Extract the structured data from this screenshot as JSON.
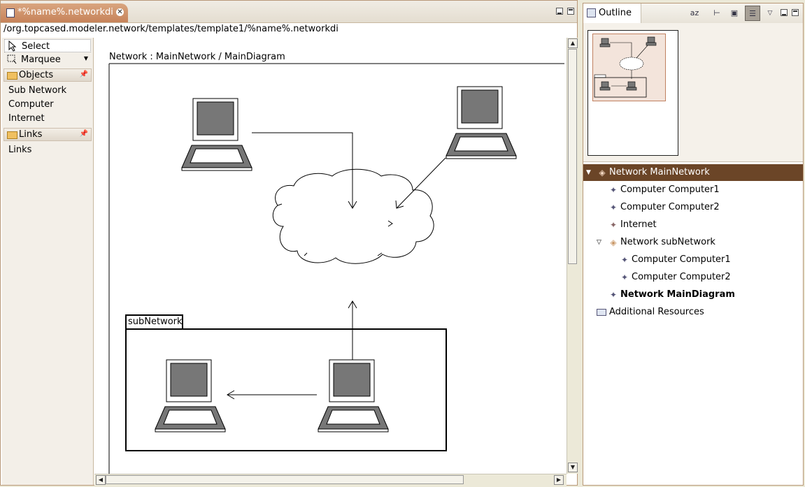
{
  "editor": {
    "tab_title": "*%name%.networkdi",
    "path": "/org.topcased.modeler.network/templates/template1/%name%.networkdi"
  },
  "palette": {
    "select_label": "Select",
    "marquee_label": "Marquee",
    "drawers": [
      {
        "label": "Objects",
        "items": [
          "Sub Network",
          "Computer",
          "Internet"
        ]
      },
      {
        "label": "Links",
        "items": [
          "Links"
        ]
      }
    ]
  },
  "diagram": {
    "frame_title": "Network : MainNetwork / MainDiagram",
    "subnetwork_label": "subNetwork"
  },
  "outline": {
    "tab_label": "Outline",
    "sort_icon_text": "az",
    "tree": [
      {
        "label": "Network MainNetwork",
        "icon": "network-diamond-icon",
        "selected": true,
        "expanded": true
      },
      {
        "label": "Computer Computer1",
        "icon": "computer-node-icon"
      },
      {
        "label": "Computer Computer2",
        "icon": "computer-node-icon"
      },
      {
        "label": "Internet",
        "icon": "internet-node-icon"
      },
      {
        "label": "Network subNetwork",
        "icon": "network-diamond-icon",
        "expanded": true
      },
      {
        "label": "Computer Computer1",
        "icon": "computer-node-icon"
      },
      {
        "label": "Computer Computer2",
        "icon": "computer-node-icon"
      },
      {
        "label": "Network MainDiagram",
        "icon": "diagram-node-icon",
        "bold": true
      },
      {
        "label": "Additional Resources",
        "icon": "resources-icon"
      }
    ]
  },
  "colors": {
    "selection": "#6b4527",
    "accent": "#c7835a"
  }
}
